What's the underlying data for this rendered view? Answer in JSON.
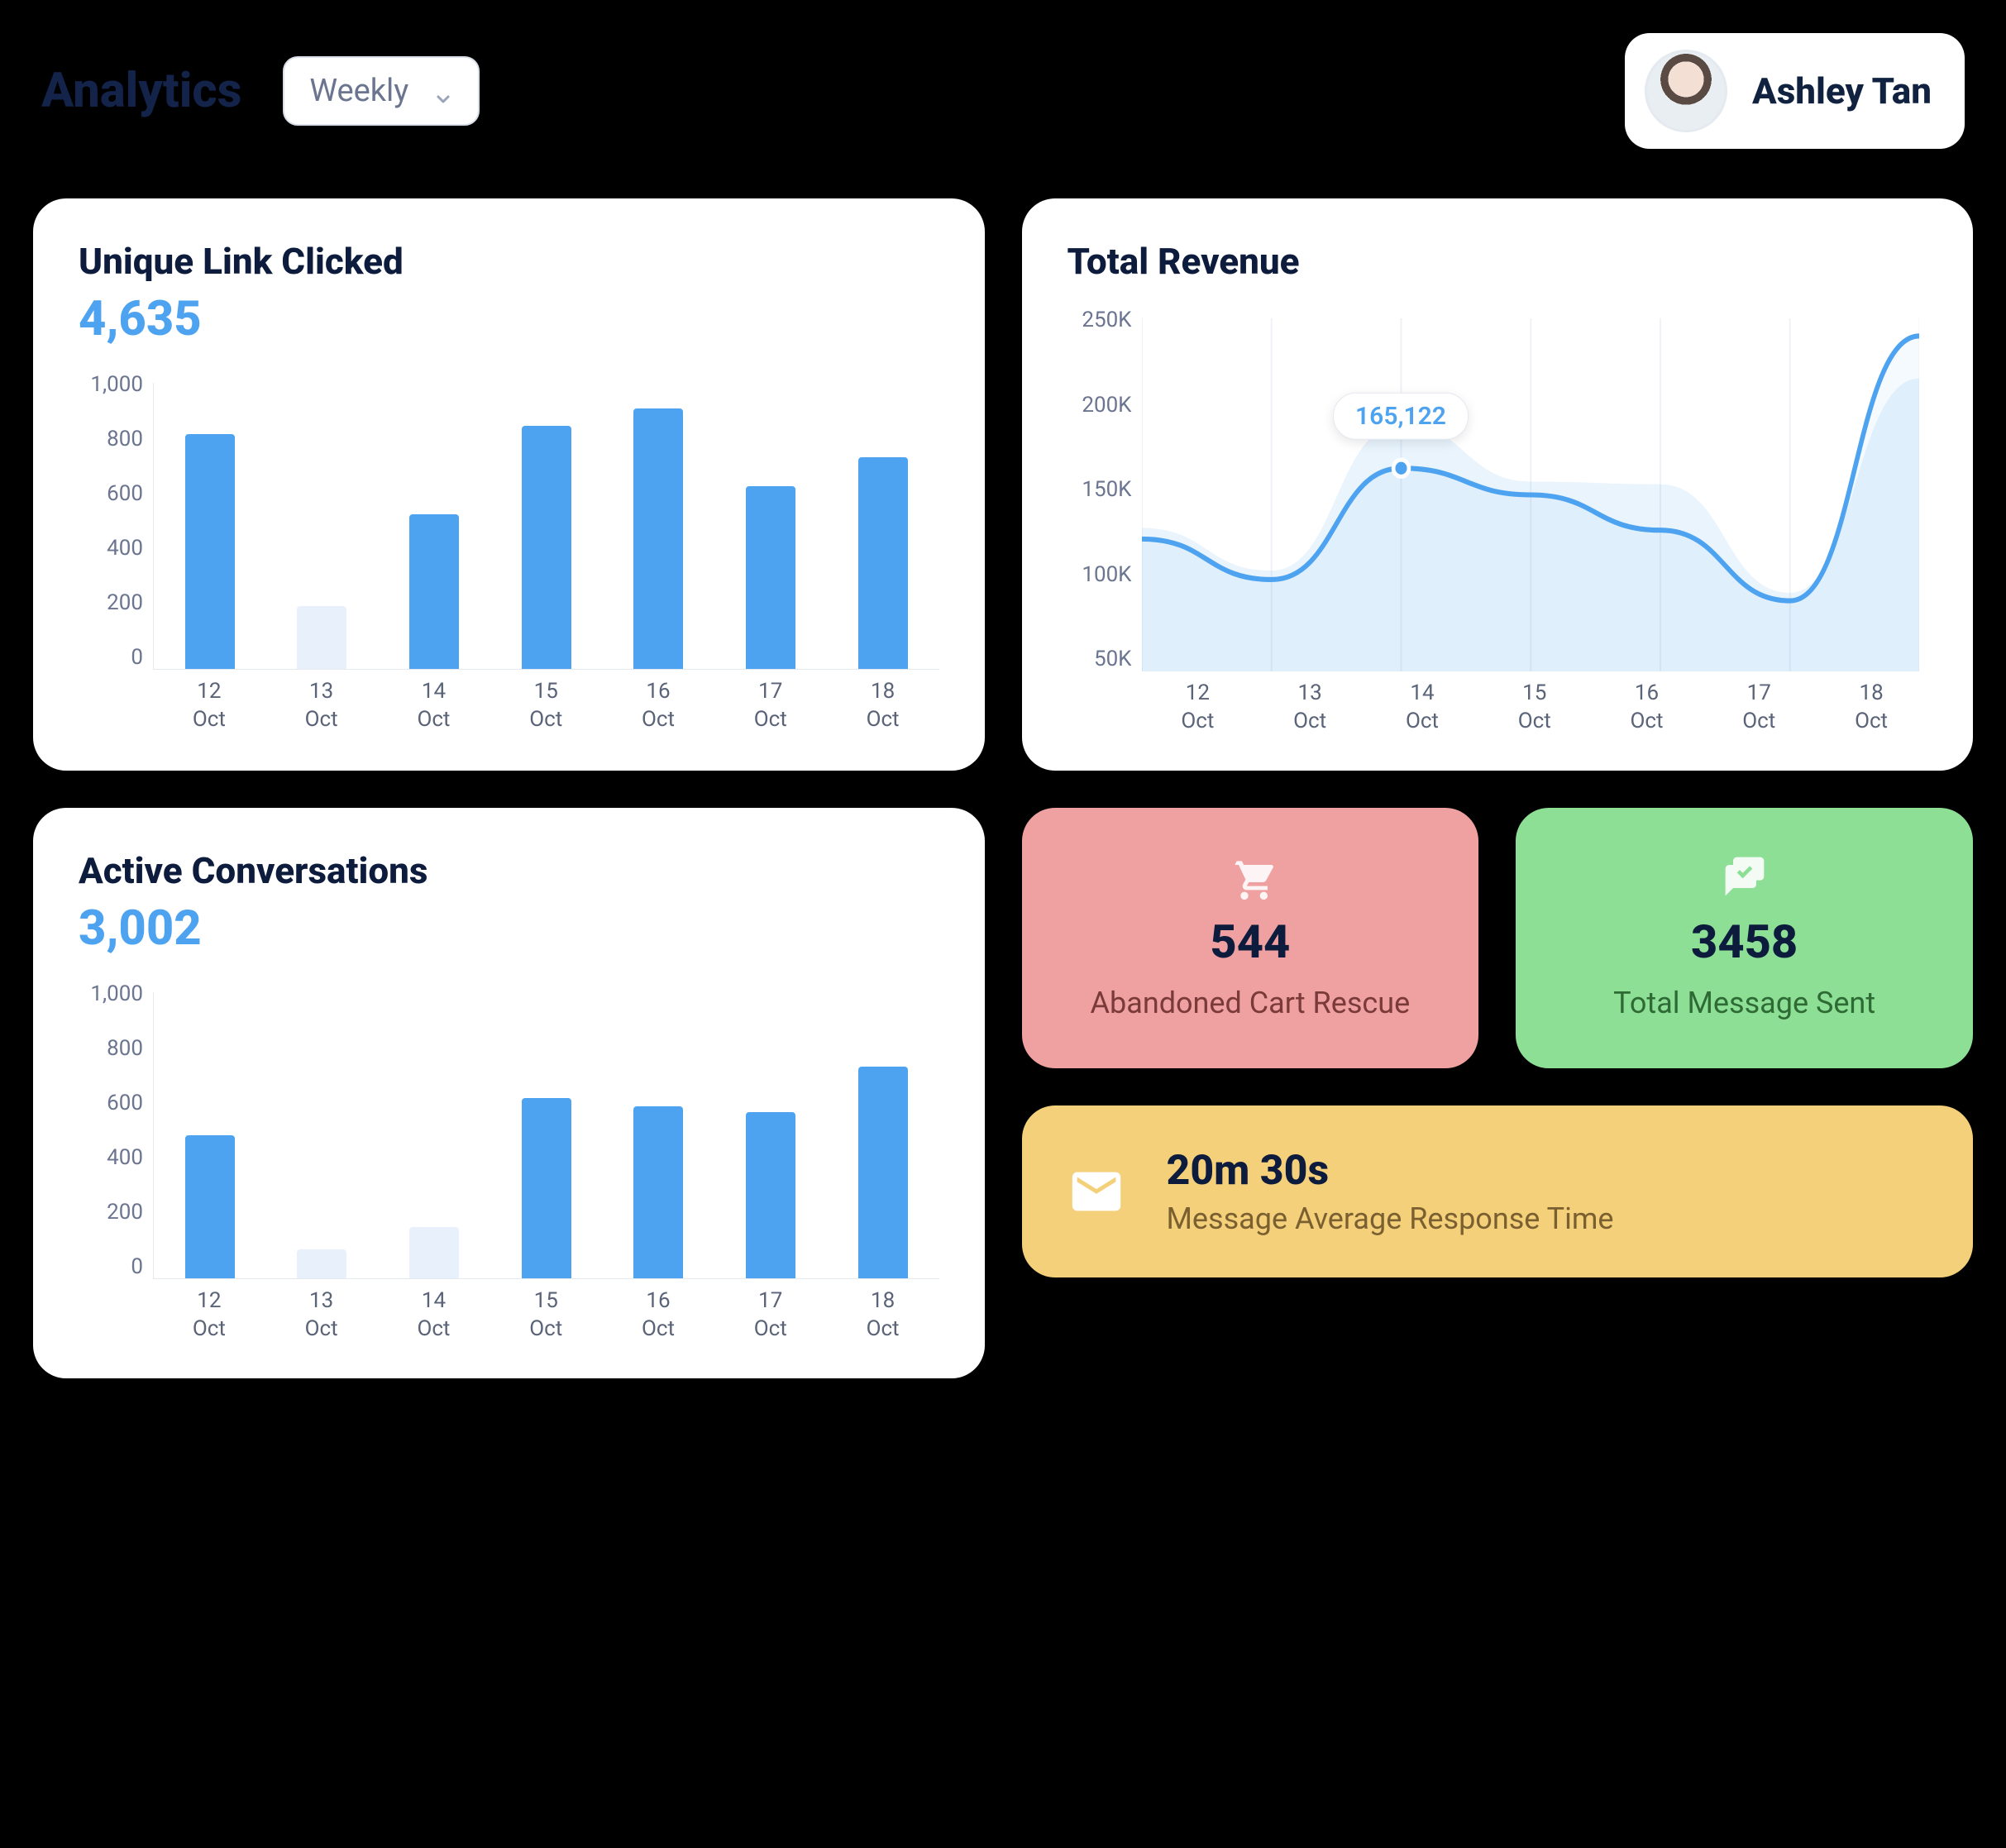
{
  "header": {
    "title": "Analytics",
    "period_selected": "Weekly"
  },
  "user": {
    "name": "Ashley Tan"
  },
  "cards": {
    "unique_link_clicked": {
      "title": "Unique Link Clicked",
      "value": "4,635"
    },
    "total_revenue": {
      "title": "Total Revenue",
      "tooltip_value": "165,122"
    },
    "active_conversations": {
      "title": "Active Conversations",
      "value": "3,002"
    }
  },
  "stats": {
    "abandoned_cart": {
      "value": "544",
      "label": "Abandoned Cart Rescue"
    },
    "total_messages": {
      "value": "3458",
      "label": "Total Message Sent"
    },
    "response_time": {
      "value": "20m 30s",
      "label": "Message Average Response Time"
    }
  },
  "chart_data": [
    {
      "id": "unique_link_clicked",
      "type": "bar",
      "title": "Unique Link Clicked",
      "categories": [
        "12 Oct",
        "13 Oct",
        "14 Oct",
        "15 Oct",
        "16 Oct",
        "17 Oct",
        "18 Oct"
      ],
      "x_tick_labels": [
        "12\nOct",
        "13\nOct",
        "14\nOct",
        "15\nOct",
        "16\nOct",
        "17\nOct",
        "18\nOct"
      ],
      "values": [
        820,
        220,
        540,
        850,
        910,
        640,
        740
      ],
      "faded_indices": [
        1
      ],
      "ylabel": "",
      "ylim": [
        0,
        1000
      ],
      "y_ticks": [
        "1,000",
        "800",
        "600",
        "400",
        "200",
        "0"
      ]
    },
    {
      "id": "total_revenue",
      "type": "line",
      "title": "Total Revenue",
      "categories": [
        "12 Oct",
        "13 Oct",
        "14 Oct",
        "15 Oct",
        "16 Oct",
        "17 Oct",
        "18 Oct"
      ],
      "x_tick_labels": [
        "12\nOct",
        "13\nOct",
        "14\nOct",
        "15\nOct",
        "16\nOct",
        "17\nOct",
        "18\nOct"
      ],
      "series": [
        {
          "name": "Revenue",
          "values": [
            125000,
            102000,
            165122,
            150000,
            130000,
            90000,
            240000
          ]
        }
      ],
      "highlight_index": 2,
      "highlight_value": "165,122",
      "ylabel": "",
      "ylim": [
        50000,
        250000
      ],
      "y_ticks": [
        "250K",
        "200K",
        "150K",
        "100K",
        "50K"
      ]
    },
    {
      "id": "active_conversations",
      "type": "bar",
      "title": "Active Conversations",
      "categories": [
        "12 Oct",
        "13 Oct",
        "14 Oct",
        "15 Oct",
        "16 Oct",
        "17 Oct",
        "18 Oct"
      ],
      "x_tick_labels": [
        "12\nOct",
        "13\nOct",
        "14\nOct",
        "15\nOct",
        "16\nOct",
        "17\nOct",
        "18\nOct"
      ],
      "values": [
        500,
        100,
        180,
        630,
        600,
        580,
        740
      ],
      "faded_indices": [
        1,
        2
      ],
      "ylabel": "",
      "ylim": [
        0,
        1000
      ],
      "y_ticks": [
        "1,000",
        "800",
        "600",
        "400",
        "200",
        "0"
      ]
    }
  ]
}
